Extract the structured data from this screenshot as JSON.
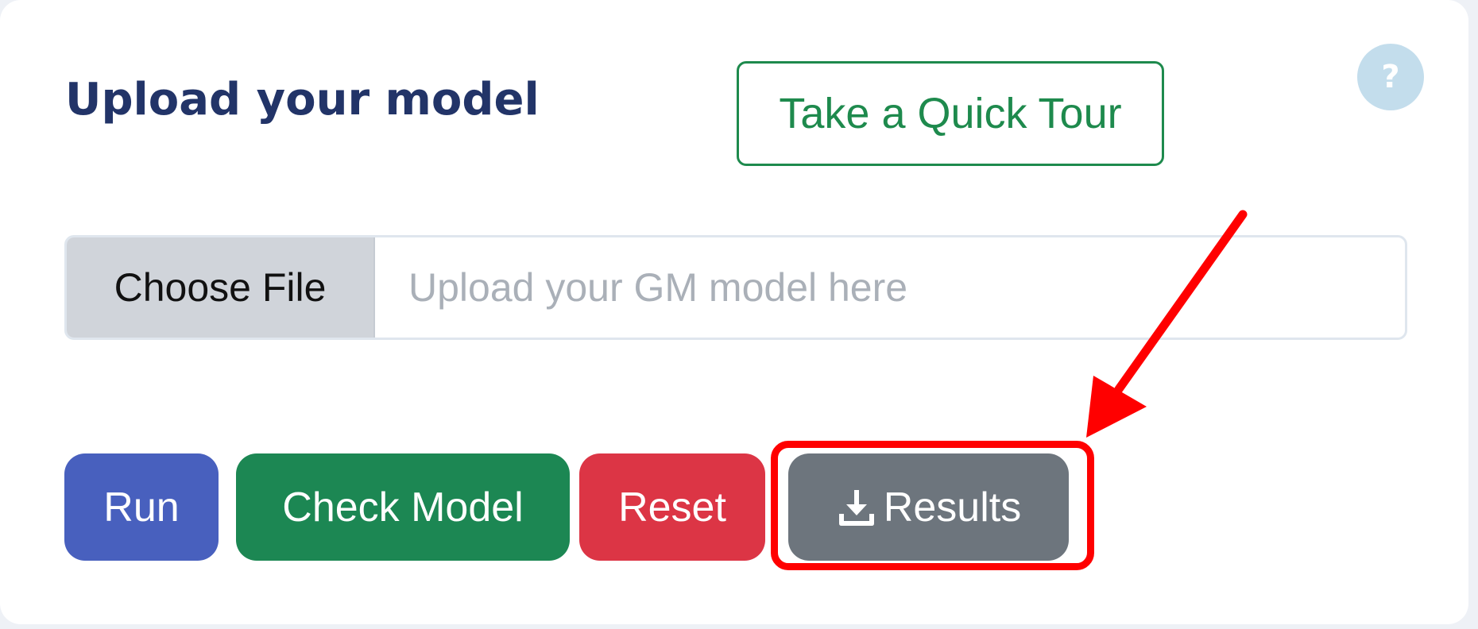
{
  "panel": {
    "title": "Upload your model"
  },
  "tour_button": {
    "label": "Take a Quick Tour"
  },
  "help_button": {
    "label": "?"
  },
  "file_input": {
    "button_label": "Choose File",
    "placeholder": "Upload your GM model here"
  },
  "actions": {
    "run_label": "Run",
    "check_label": "Check Model",
    "reset_label": "Reset",
    "results_label": "Results",
    "results_icon": "download-icon"
  },
  "annotation": {
    "color": "#ff0000",
    "target": "results-button"
  },
  "colors": {
    "title": "#223468",
    "run": "#4860be",
    "check_model": "#1c8753",
    "reset": "#dc3545",
    "results": "#6d757d",
    "tour_outline": "#1e8a4d",
    "help": "#c3ddec"
  }
}
